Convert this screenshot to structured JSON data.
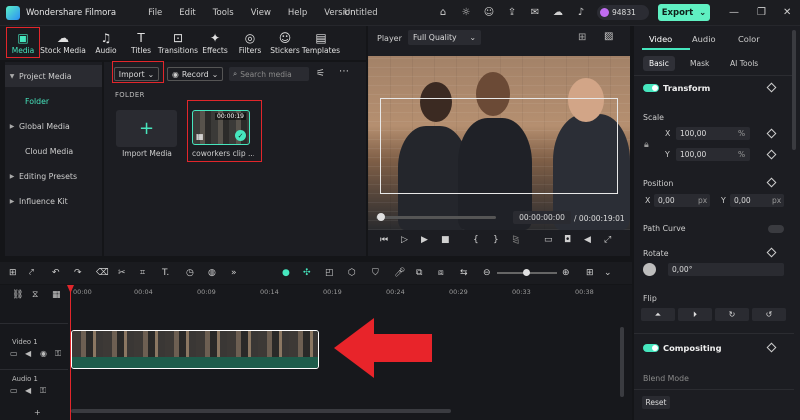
{
  "titlebar": {
    "app_name": "Wondershare Filmora",
    "menus": [
      "File",
      "Edit",
      "Tools",
      "View",
      "Help",
      "Version"
    ],
    "project_title": "Untitled",
    "credits": "94831",
    "export_label": "Export"
  },
  "toolbar": {
    "items": [
      {
        "label": "Media",
        "icon": "media-icon",
        "glyph": "▣"
      },
      {
        "label": "Stock Media",
        "icon": "stock-media-icon",
        "glyph": "☁"
      },
      {
        "label": "Audio",
        "icon": "audio-icon",
        "glyph": "♫"
      },
      {
        "label": "Titles",
        "icon": "titles-icon",
        "glyph": "T"
      },
      {
        "label": "Transitions",
        "icon": "transitions-icon",
        "glyph": "⊡"
      },
      {
        "label": "Effects",
        "icon": "effects-icon",
        "glyph": "✦"
      },
      {
        "label": "Filters",
        "icon": "filters-icon",
        "glyph": "◎"
      },
      {
        "label": "Stickers",
        "icon": "stickers-icon",
        "glyph": "☺"
      },
      {
        "label": "Templates",
        "icon": "templates-icon",
        "glyph": "▤"
      }
    ]
  },
  "sidebar": {
    "items": [
      "Project Media",
      "Folder",
      "Global Media",
      "Cloud Media",
      "Editing Presets",
      "Influence Kit"
    ]
  },
  "media": {
    "import_label": "Import",
    "record_label": "Record",
    "search_placeholder": "Search media",
    "folder_title": "FOLDER",
    "import_tile_label": "Import Media",
    "clip_name": "coworkers clip ...",
    "clip_duration": "00:00:19"
  },
  "player": {
    "label": "Player",
    "quality": "Full Quality",
    "current_time": "00:00:00:00",
    "separator": "/",
    "total_time": "00:00:19:01"
  },
  "properties": {
    "tabs": [
      "Video",
      "Audio",
      "Color"
    ],
    "subtabs": [
      "Basic",
      "Mask",
      "AI Tools"
    ],
    "transform": "Transform",
    "scale": "Scale",
    "scale_x": "100,00",
    "scale_y": "100,00",
    "scale_unit": "%",
    "position": "Position",
    "pos_x": "0,00",
    "pos_y": "0,00",
    "pos_unit": "px",
    "x_label": "X",
    "y_label": "Y",
    "path_curve": "Path Curve",
    "rotate": "Rotate",
    "rotate_value": "0,00°",
    "flip": "Flip",
    "compositing": "Compositing",
    "blend_mode": "Blend Mode",
    "reset": "Reset"
  },
  "timeline": {
    "ruler": [
      "00:00",
      "00:04",
      "00:09",
      "00:14",
      "00:19",
      "00:24",
      "00:29",
      "00:33",
      "00:38"
    ],
    "video_track": "Video 1",
    "audio_track": "Audio 1"
  },
  "colors": {
    "accent": "#46e6be",
    "highlight": "#e2262b",
    "export_bg": "#5ff0c2"
  }
}
